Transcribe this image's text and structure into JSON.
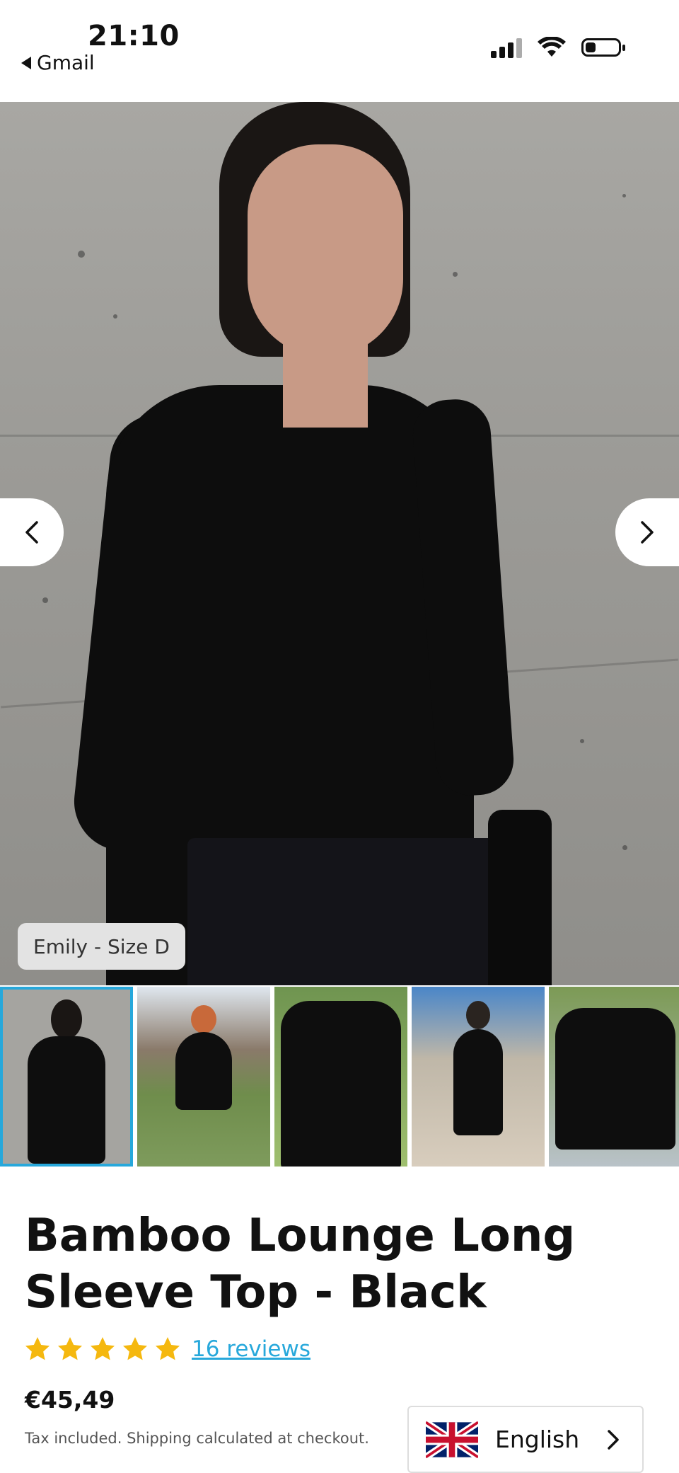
{
  "status_bar": {
    "time": "21:10",
    "back_app": "Gmail"
  },
  "hero": {
    "caption": "Emily - Size D",
    "prev_icon": "chevron-left-icon",
    "next_icon": "chevron-right-icon"
  },
  "product": {
    "title": "Bamboo Lounge Long Sleeve Top - Black",
    "rating_stars": 5,
    "reviews_link": "16 reviews",
    "price": "€45,49",
    "tax_note": "Tax included. Shipping calculated at checkout."
  },
  "language_selector": {
    "label": "English",
    "flag_icon": "uk-flag-icon"
  },
  "colors": {
    "accent": "#27a8db",
    "star": "#f5b80f"
  }
}
